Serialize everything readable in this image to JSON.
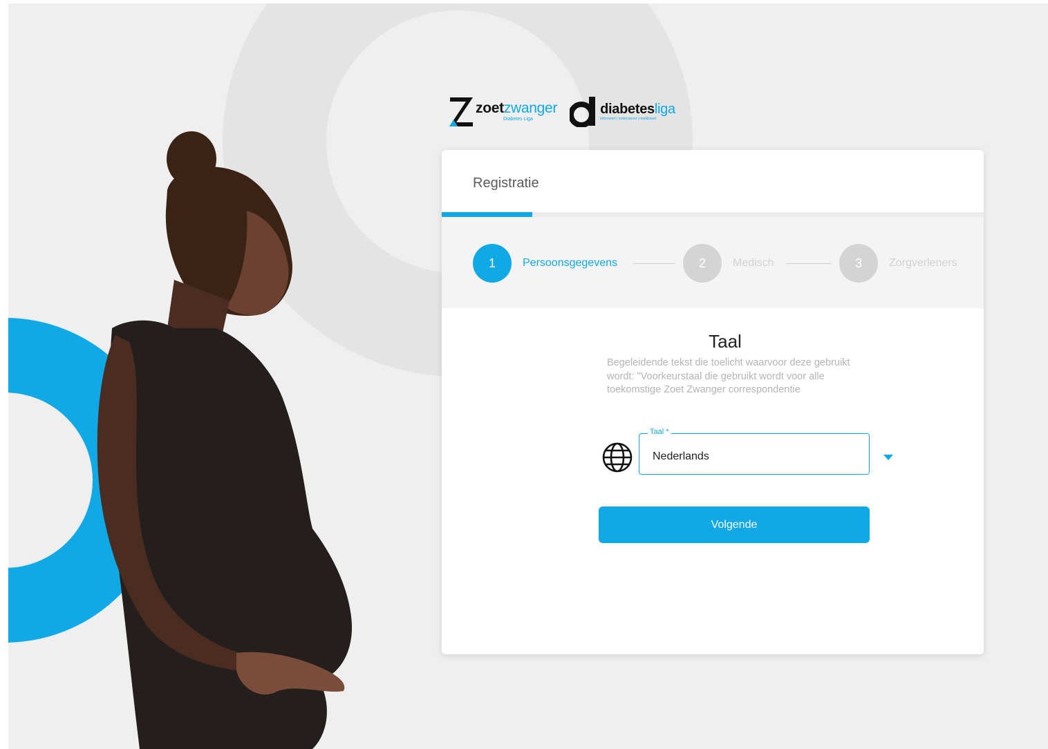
{
  "logos": {
    "zoetzwanger": {
      "part1": "zoet",
      "part2": "zwanger",
      "sub": "Diabetes Liga"
    },
    "diabetesliga": {
      "part1": "diabetes",
      "part2": "liga",
      "sub": "informeert | ondersteunt | mobiliseert"
    }
  },
  "card": {
    "title": "Registratie",
    "progress_fraction": 0.167
  },
  "stepper": {
    "steps": [
      {
        "number": "1",
        "label": "Persoonsgegevens",
        "state": "active"
      },
      {
        "number": "2",
        "label": "Medisch",
        "state": "inactive"
      },
      {
        "number": "3",
        "label": "Zorgverleners",
        "state": "inactive"
      }
    ]
  },
  "form": {
    "section_title": "Taal",
    "description": "Begeleidende tekst die toelicht waarvoor deze gebruikt wordt: \"Voorkeurstaal die gebruikt wordt voor alle toekomstige Zoet Zwanger correspondentie",
    "field_label": "Taal *",
    "field_value": "Nederlands",
    "globe_icon": "globe-icon",
    "dropdown_icon": "caret-down-icon",
    "next_button": "Volgende"
  },
  "colors": {
    "accent": "#10a9e6",
    "background": "#efefef",
    "card": "#ffffff",
    "inactive_step": "#d4d4d4"
  }
}
